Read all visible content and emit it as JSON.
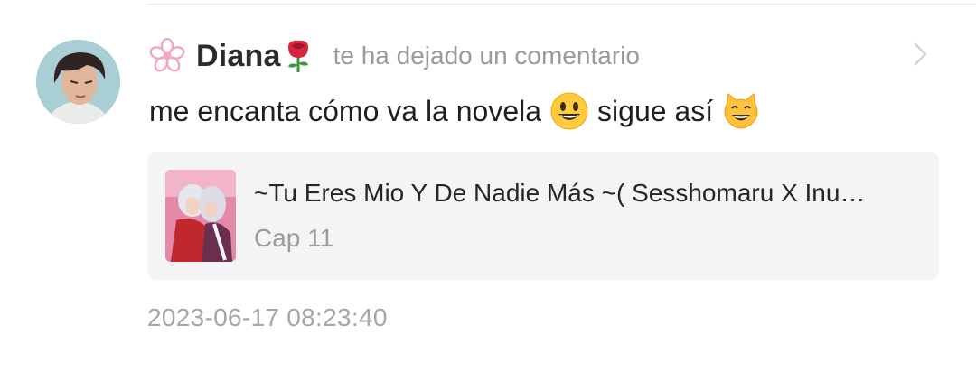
{
  "notification": {
    "username": "Diana",
    "action_text": "te ha dejado un comentario",
    "comment_text_part1": "me encanta cómo va la novela",
    "comment_text_part2": "sigue así",
    "emojis": [
      "grinning-face",
      "grinning-cat"
    ],
    "card": {
      "title": "~Tu Eres Mio Y De Nadie Más ~( Sesshomaru X Inu…",
      "chapter": "Cap 11"
    },
    "timestamp": "2023-06-17 08:23:40"
  },
  "icons": {
    "badge": "sakura-flower-icon",
    "name_emoji": "rose-icon",
    "navigate": "chevron-right-icon"
  },
  "colors": {
    "username": "#2b2b2b",
    "secondary_text": "#9a9a9a",
    "card_background": "#f4f4f6",
    "badge_pink": "#f1a7c3"
  }
}
